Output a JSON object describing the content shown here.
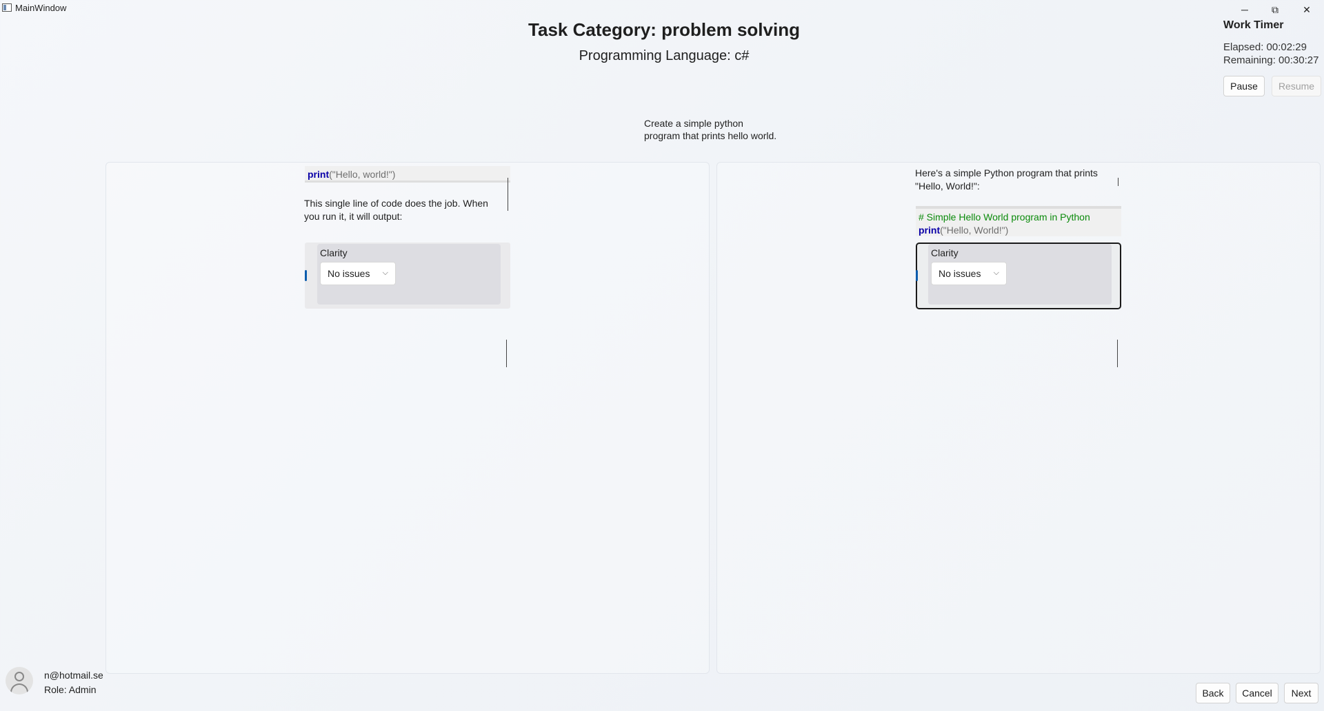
{
  "window": {
    "title": "MainWindow",
    "minimize": "─",
    "maximize": "⧉",
    "close": "✕"
  },
  "header": {
    "task_category": "Task Category: problem solving",
    "language": "Programming Language: c#"
  },
  "timer": {
    "title": "Work Timer",
    "elapsed": "Elapsed: 00:02:29",
    "remaining": "Remaining: 00:30:27",
    "pause_label": "Pause",
    "resume_label": "Resume"
  },
  "prompt": {
    "line1": "Create a simple python",
    "line2": "program that prints hello world."
  },
  "left_response": {
    "code_kw": "print",
    "code_args": "(\"Hello, world!\")",
    "text_line1": "This single line of code does the job. When",
    "text_line2": "you run it, it will output:",
    "rating": {
      "label": "Clarity",
      "value": "No issues"
    }
  },
  "right_response": {
    "intro_line1": "Here's a simple Python program that prints",
    "intro_line2": "\"Hello, World!\":",
    "code_comment": "# Simple Hello World program in Python",
    "code_kw": "print",
    "code_args": "(\"Hello, World!\")",
    "rating": {
      "label": "Clarity",
      "value": "No issues"
    }
  },
  "user": {
    "email": "n@hotmail.se",
    "role": "Role: Admin"
  },
  "footer": {
    "back_label": "Back",
    "cancel_label": "Cancel",
    "next_label": "Next"
  },
  "icons": {
    "dropdown": "chevron-down-icon",
    "avatar": "user-avatar-icon"
  },
  "colors": {
    "accent": "#0b5cad",
    "keyword": "#0a00a8",
    "comment": "#0a8a0a"
  }
}
